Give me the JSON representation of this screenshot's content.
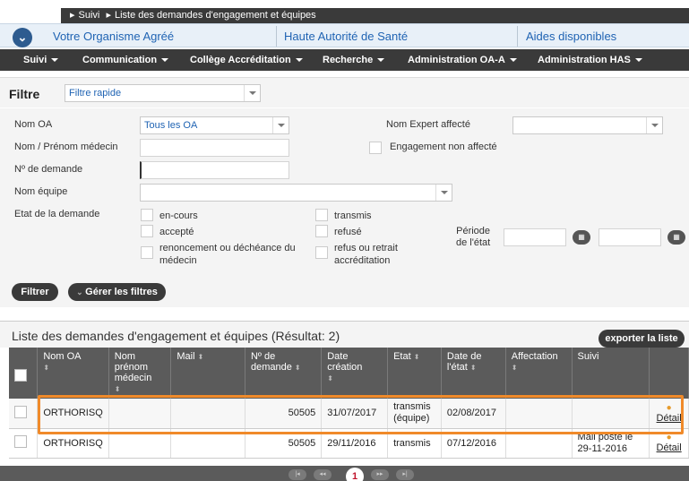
{
  "breadcrumb": {
    "items": [
      "Suivi",
      "Liste des demandes d'engagement et équipes"
    ]
  },
  "topbar": {
    "links": [
      "Votre Organisme Agréé",
      "Haute Autorité de Santé",
      "Aides disponibles"
    ]
  },
  "nav": {
    "items": [
      "Suivi",
      "Communication",
      "Collège Accréditation",
      "Recherche",
      "Administration OA-A",
      "Administration HAS"
    ]
  },
  "filter": {
    "label": "Filtre",
    "quick_select": "Filtre rapide",
    "fields": {
      "nom_oa_label": "Nom OA",
      "nom_oa_value": "Tous les OA",
      "expert_label": "Nom Expert affecté",
      "medecin_label": "Nom / Prénom médecin",
      "engagement_label": "Engagement non affecté",
      "demande_label": "Nº de demande",
      "equipe_label": "Nom équipe",
      "etat_label": "Etat de la demande",
      "periode_label_1": "Période",
      "periode_label_2": "de l'état"
    },
    "states": {
      "en_cours": "en-cours",
      "transmis": "transmis",
      "accepte": "accepté",
      "refuse": "refusé",
      "renoncement_1": "renoncement ou déchéance du",
      "renoncement_2": "médecin",
      "refus_retrait_1": "refus ou retrait",
      "refus_retrait_2": "accréditation"
    },
    "filtrer_button": "Filtrer",
    "gerer_button": "Gérer les filtres"
  },
  "results": {
    "title": "Liste des demandes d'engagement et équipes (Résultat: 2)",
    "export_button": "exporter la liste",
    "columns": [
      "Nom OA",
      "Nom prénom médecin",
      "Mail",
      "Nº de demande",
      "Date création",
      "Etat",
      "Date de l'état",
      "Affectation",
      "Suivi"
    ],
    "rows": [
      {
        "nom_oa": "ORTHORISQ",
        "medecin": "",
        "mail": "",
        "num": "50505",
        "date_creation": "31/07/2017",
        "etat_1": "transmis",
        "etat_2": "(équipe)",
        "date_etat": "02/08/2017",
        "affectation": "",
        "suivi_1": "",
        "suivi_2": "",
        "detail": "Détail"
      },
      {
        "nom_oa": "ORTHORISQ",
        "medecin": "",
        "mail": "",
        "num": "50505",
        "date_creation": "29/11/2016",
        "etat_1": "transmis",
        "etat_2": "",
        "date_etat": "07/12/2016",
        "affectation": "",
        "suivi_1": "Mail posté le",
        "suivi_2": "29-11-2016",
        "detail": "Détail"
      }
    ]
  },
  "pager": {
    "current": "1"
  },
  "colors": {
    "highlight": "#f08a2a",
    "link": "#1f63b3",
    "dark": "#3a3a3a",
    "page_current": "#c0142c"
  }
}
